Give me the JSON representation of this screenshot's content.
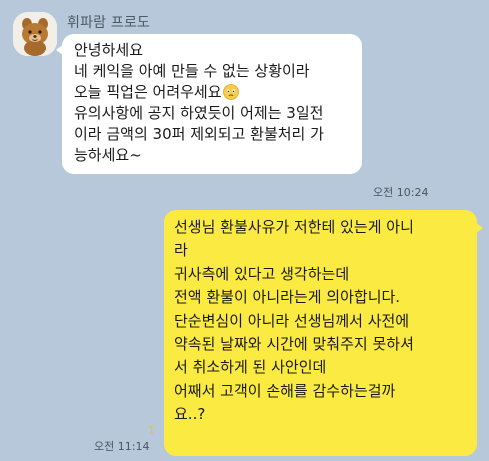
{
  "chat": {
    "background_color": "#b6c8d9",
    "incoming": {
      "sender_name": "휘파람 프로도",
      "avatar_icon": "frodo-character-avatar",
      "lines": [
        "안녕하세요",
        "네 케익을 아예 만들 수 없는 상황이라",
        "오늘 픽업은 어려우세요",
        "유의사항에 공지 하였듯이 어제는 3일전",
        "이라 금액의 30퍼 제외되고 환불처리 가",
        "능하세요~"
      ],
      "emoji_icon": "sad-face-emoji",
      "time": "오전 10:24",
      "bubble_color": "#ffffff"
    },
    "outgoing": {
      "lines": [
        "선생님 환불사유가 저한테 있는게 아니",
        "라",
        "귀사측에 있다고 생각하는데",
        "전액 환불이 아니라는게 의아합니다.",
        "단순변심이 아니라 선생님께서 사전에",
        "약속된 날짜와 시간에 맞춰주지 못하셔",
        "서 취소하게 된 사안인데",
        "어째서 고객이 손해를 감수하는걸까",
        "요..?"
      ],
      "unread_count": "1",
      "time": "오전 11:14",
      "bubble_color": "#fbea41"
    }
  }
}
